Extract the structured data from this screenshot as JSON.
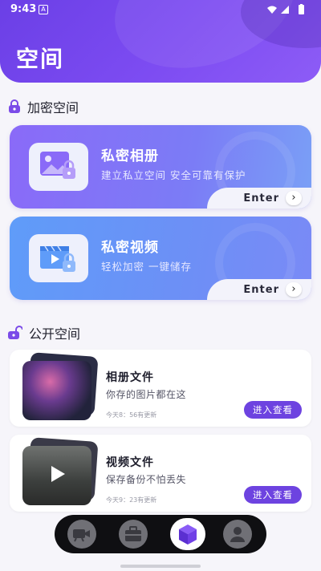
{
  "status_bar": {
    "time": "9:43",
    "notification_letter": "A"
  },
  "header": {
    "title": "空间"
  },
  "encrypted_section": {
    "label": "加密空间",
    "cards": [
      {
        "title": "私密相册",
        "desc": "建立私立空间  安全可靠有保护",
        "enter": "Enter",
        "arrow": "›"
      },
      {
        "title": "私密视频",
        "desc": "轻松加密  一键储存",
        "enter": "Enter",
        "arrow": "›"
      }
    ]
  },
  "public_section": {
    "label": "公开空间",
    "items": [
      {
        "title": "相册文件",
        "desc": "你存的图片都在这",
        "time": "今天8：56有更新",
        "button": "进入查看"
      },
      {
        "title": "视频文件",
        "desc": "保存备份不怕丢失",
        "time": "今天9：23有更新",
        "button": "进入查看"
      }
    ]
  },
  "bottom_nav": {
    "items": [
      {
        "icon": "video-camera-icon"
      },
      {
        "icon": "briefcase-icon"
      },
      {
        "icon": "cube-icon",
        "active": true
      },
      {
        "icon": "person-icon"
      }
    ]
  },
  "colors": {
    "accent": "#6d43e0",
    "header": "#7446ea",
    "album_card": "#8a6af8",
    "video_card": "#6f94f7"
  }
}
